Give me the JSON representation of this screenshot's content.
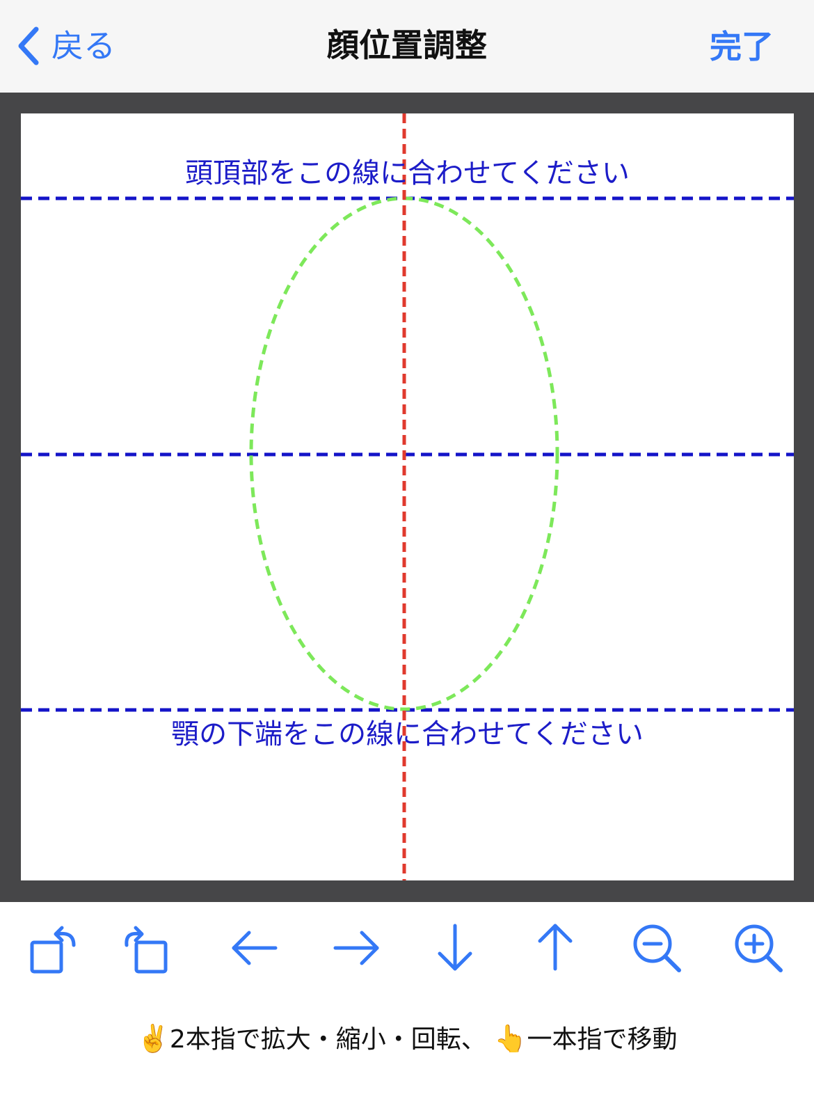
{
  "navbar": {
    "back_label": "戻る",
    "title": "顔位置調整",
    "done_label": "完了"
  },
  "canvas": {
    "top_guide_text": "頭頂部をこの線に合わせてください",
    "bottom_guide_text": "顎の下端をこの線に合わせてください",
    "colors": {
      "guide_line": "#1414c8",
      "center_line": "#e03a2e",
      "face_oval": "#7de85a",
      "frame": "#464648"
    }
  },
  "toolbar": {
    "tools": [
      {
        "name": "rotate-left-icon"
      },
      {
        "name": "rotate-right-icon"
      },
      {
        "name": "arrow-left-icon"
      },
      {
        "name": "arrow-right-icon"
      },
      {
        "name": "arrow-down-icon"
      },
      {
        "name": "arrow-up-icon"
      },
      {
        "name": "zoom-out-icon"
      },
      {
        "name": "zoom-in-icon"
      }
    ],
    "accent_color": "#3478f6"
  },
  "hint": {
    "emoji_two_fingers": "✌️",
    "two_finger_text": "2本指で拡大・縮小・回転、",
    "emoji_one_finger": "👆",
    "one_finger_text": "一本指で移動"
  }
}
